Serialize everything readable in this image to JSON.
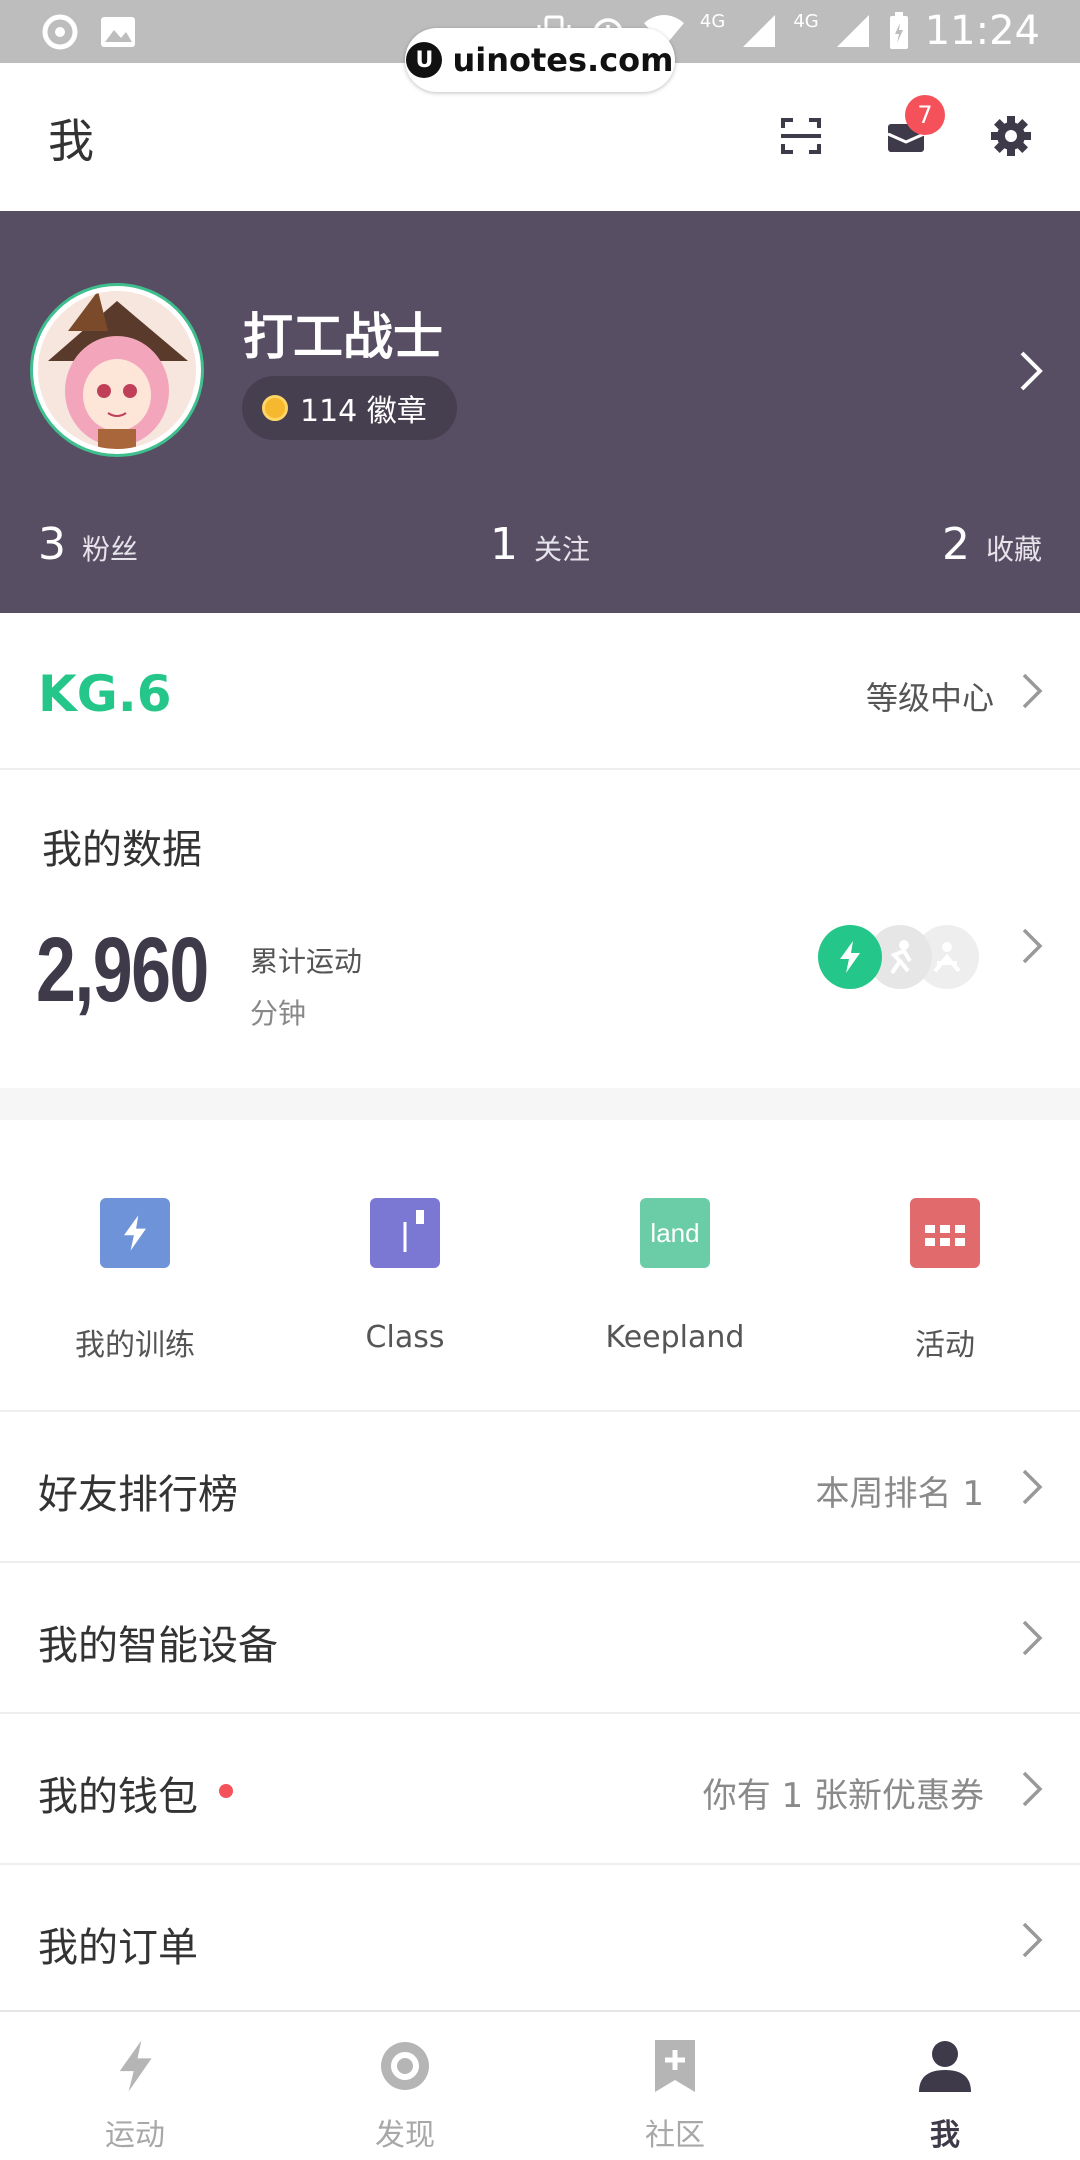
{
  "status_bar": {
    "time": "11:24",
    "net1": "4G",
    "net2": "4G"
  },
  "watermark": {
    "text": "uinotes.com",
    "logo": "U"
  },
  "header": {
    "title": "我",
    "badge_count": "7"
  },
  "profile": {
    "username": "打工战士",
    "badges": "114 徽章",
    "stats": [
      {
        "num": "3",
        "label": "粉丝"
      },
      {
        "num": "1",
        "label": "关注"
      },
      {
        "num": "2",
        "label": "收藏"
      }
    ]
  },
  "level": {
    "kg": "KG.6",
    "center": "等级中心"
  },
  "mydata": {
    "title": "我的数据",
    "total": "2,960",
    "sub1": "累计运动",
    "sub2": "分钟"
  },
  "tools": [
    {
      "label": "我的训练",
      "icon": "lightning-icon",
      "color": "#6f93d8"
    },
    {
      "label": "Class",
      "icon": "book-icon",
      "color": "#7b78d4"
    },
    {
      "label": "Keepland",
      "icon": "land-icon",
      "color": "#6bcda7",
      "icon_text": "land"
    },
    {
      "label": "活动",
      "icon": "calendar-icon",
      "color": "#e06a6c"
    }
  ],
  "rows": [
    {
      "label": "好友排行榜",
      "value": "本周排名 1"
    },
    {
      "label": "我的智能设备",
      "value": ""
    },
    {
      "label": "我的钱包",
      "value": "你有 1 张新优惠券"
    },
    {
      "label": "我的订单",
      "value": ""
    }
  ],
  "nav": [
    {
      "label": "运动",
      "icon": "lightning-icon"
    },
    {
      "label": "发现",
      "icon": "discover-icon"
    },
    {
      "label": "社区",
      "icon": "bookmark-plus-icon"
    },
    {
      "label": "我",
      "icon": "person-icon",
      "active": true
    }
  ],
  "colors": {
    "accent_green": "#24c789",
    "profile_bg": "#574e63",
    "badge_red": "#f4515a"
  }
}
